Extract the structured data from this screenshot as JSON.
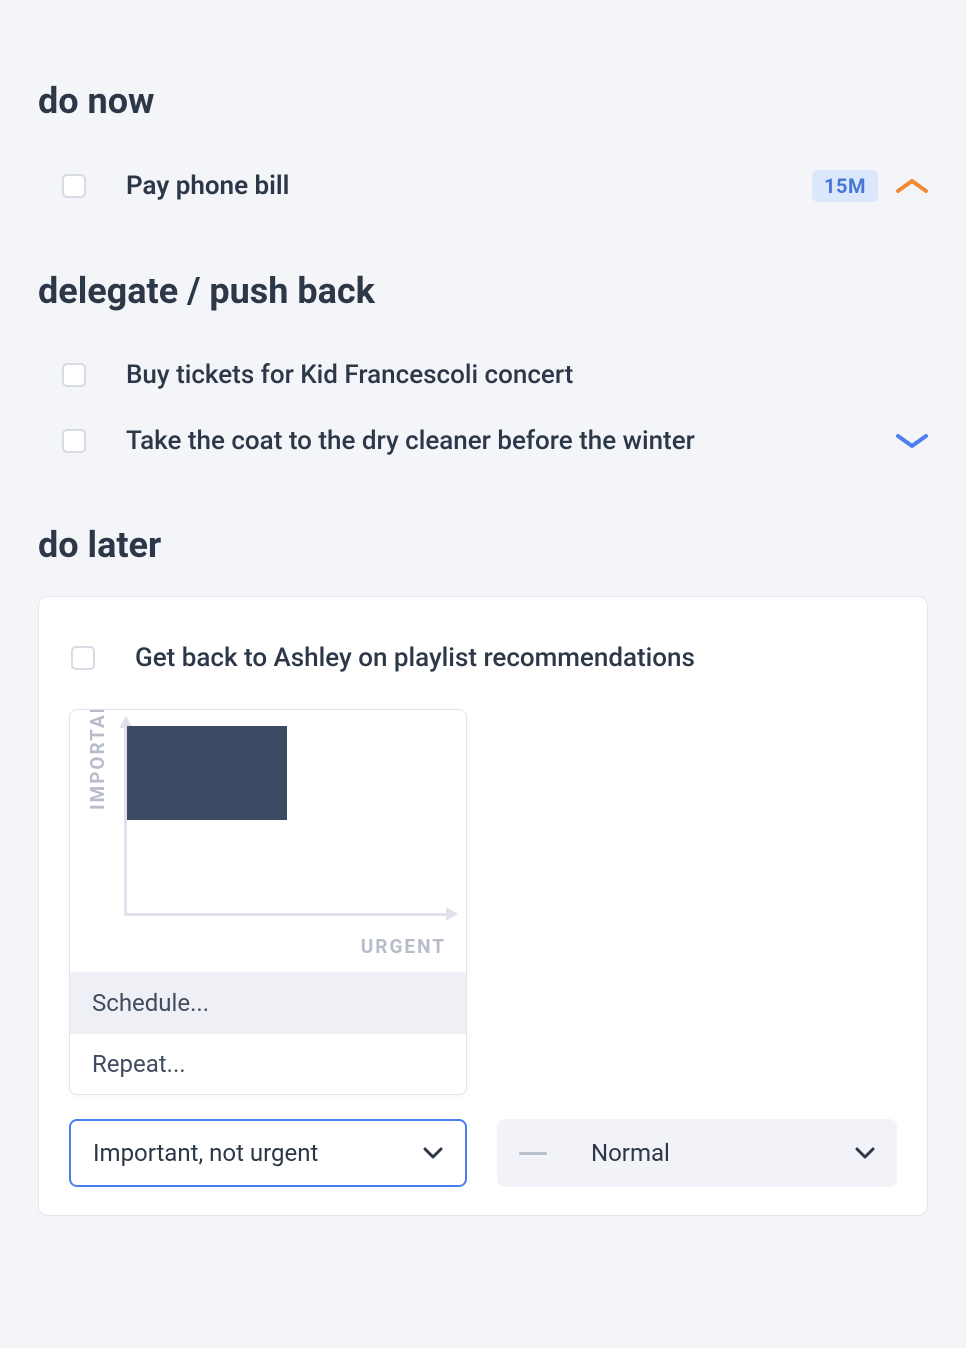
{
  "sections": {
    "do_now": {
      "title": "do now",
      "tasks": [
        {
          "title": "Pay phone bill",
          "duration": "15M",
          "priority_icon": "up"
        }
      ]
    },
    "delegate": {
      "title": "delegate / push back",
      "tasks": [
        {
          "title": "Buy tickets for Kid Francescoli concert"
        },
        {
          "title": "Take the coat to the dry cleaner before the winter",
          "priority_icon": "down"
        }
      ]
    },
    "do_later": {
      "title": "do later",
      "tasks": [
        {
          "title": "Get back to Ashley on playlist recommendations"
        }
      ]
    }
  },
  "matrix": {
    "y_axis_label": "IMPORTANT",
    "x_axis_label": "URGENT",
    "menu": {
      "schedule": "Schedule...",
      "repeat": "Repeat..."
    }
  },
  "selects": {
    "priority": {
      "value": "Important, not urgent"
    },
    "repeat": {
      "value": "Normal"
    }
  },
  "colors": {
    "accent_orange": "#f08a33",
    "accent_blue": "#4b7ff1",
    "quad_fill": "#3d4a63"
  }
}
